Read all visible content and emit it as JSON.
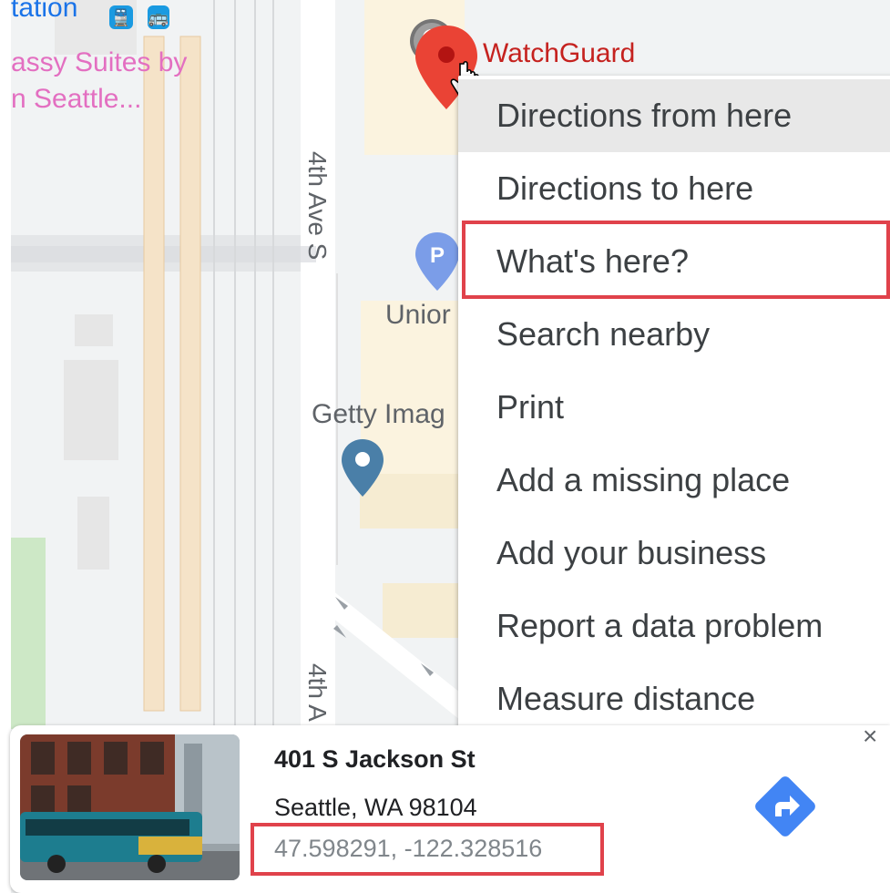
{
  "map": {
    "labels": {
      "station": "tation",
      "hotel_line1": "assy Suites by",
      "hotel_line2": "n Seattle...",
      "watchguard": "WatchGuard",
      "street_top": "4th Ave S",
      "street_bottom": "4th A",
      "union": "Unior",
      "getty": "Getty Imag"
    },
    "icons": {
      "transit_train": "🚆",
      "transit_bus": "🚌"
    },
    "colors": {
      "background": "#f1f3f4",
      "road": "#ffffff",
      "rail": "#f5e3c8",
      "building_tan": "#fbf3df",
      "park": "#cde8c6",
      "pin_red": "#ea4335",
      "pin_blue": "#3b6fa0",
      "parking_blue": "#7b9de8"
    }
  },
  "context_menu": {
    "items": [
      {
        "label": "Directions from here"
      },
      {
        "label": "Directions to here"
      },
      {
        "label": "What's here?"
      },
      {
        "label": "Search nearby"
      },
      {
        "label": "Print"
      },
      {
        "label": "Add a missing place"
      },
      {
        "label": "Add your business"
      },
      {
        "label": "Report a data problem"
      },
      {
        "label": "Measure distance"
      }
    ]
  },
  "info_card": {
    "address": "401 S Jackson St",
    "city": "Seattle, WA 98104",
    "coordinates": "47.598291, -122.328516",
    "close_symbol": "×"
  },
  "highlight_color": "#e0424b"
}
